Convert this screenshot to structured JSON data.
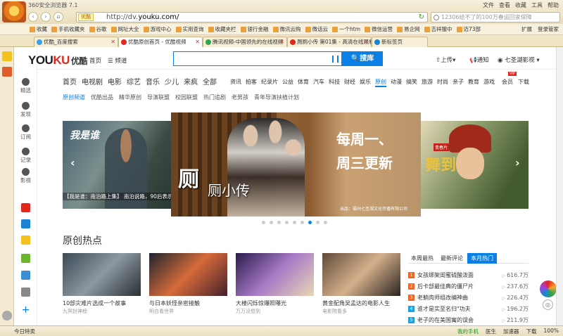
{
  "browser": {
    "title": "360安全浏览器 7.1",
    "menu": [
      "文件",
      "查看",
      "收藏",
      "工具",
      "帮助"
    ],
    "address_badge": "优酷",
    "url_prefix": "http://dv.",
    "url_domain": "youku.com/",
    "search_placeholder": "12306给不了的100万春运回家保障",
    "favorites": [
      "收藏",
      "手机收藏夹",
      "谷歌",
      "网址大全",
      "游戏中心",
      "实用查询",
      "收藏夹栏",
      "银行金融",
      "微讯云购",
      "微话云",
      "一个htm",
      "微信运营",
      "易企网",
      "吉祥服中",
      "迈73部",
      "移动互联",
      "精品采谱"
    ],
    "fav_right": [
      "扩展",
      "登录管家"
    ],
    "tabs": [
      {
        "label": "优酷_百度搜索"
      },
      {
        "label": "优酷原创首页 - 优酷视频"
      },
      {
        "label": "腾讯视频-中国领先的在线视频"
      },
      {
        "label": "厕厕小传 第01集 - 高清在线观看"
      },
      {
        "label": "新标签页"
      }
    ],
    "status_left": "今日特卖",
    "status_right": [
      "我的手机",
      "医生",
      "加速器",
      "下载",
      "100%"
    ]
  },
  "pagenav": [
    "精选",
    "发现",
    "订阅",
    "记录",
    "影视"
  ],
  "youku": {
    "logo_you": "YOU",
    "logo_ku": "KU",
    "logo_cn": "优酷",
    "home": "首页",
    "channel": "频道",
    "search_btn": "搜库",
    "upload": "上传",
    "notice": "通知",
    "user": "七圣湖影视"
  },
  "channels_big": [
    "首页",
    "电视剧",
    "电影",
    "综艺",
    "音乐",
    "少儿",
    "来疯",
    "全部"
  ],
  "channels_small": [
    "资讯",
    "拍客",
    "纪录片",
    "公益",
    "体育",
    "汽车",
    "科技",
    "财经",
    "娱乐",
    "原创",
    "动漫",
    "搞笑",
    "旅游",
    "时尚",
    "亲子",
    "教育",
    "游戏"
  ],
  "member": "会员",
  "vip": "VIP",
  "download": "下载",
  "subnav": [
    "原创频道",
    "优酷出品",
    "精华原创",
    "导演联盟",
    "校园联盟",
    "热门追剧",
    "老男孩",
    "青年导演扶植计划"
  ],
  "carousel": {
    "left_logo": "我是谁",
    "left_caption": "【我是谁：南泊路上集】 南泊说路，90后表示精彩纷呈学霸国人\"嗨啦\"",
    "main_calli": "厕",
    "main_calli2": "厕小传",
    "main_head1": "每周一、",
    "main_head2": "周三更新",
    "main_credit": "出品：福州七圣湖文化传播有限公司",
    "right_text": "舞到",
    "right_tag": "青春片",
    "dots": 9,
    "active_dot": 6
  },
  "hot": {
    "title": "原创热点",
    "items": [
      {
        "title": "10部灾难片选成一个故事",
        "source": "九冥封神榜",
        "colors": [
          "#3b4a55",
          "#8c98a2",
          "#2a2f33"
        ]
      },
      {
        "title": "与日本妖怪亲密接触",
        "source": "明白看世界",
        "colors": [
          "#1e2530",
          "#d66a3a",
          "#44202a"
        ]
      },
      {
        "title": "大楼闪烁惊爆照曝光",
        "source": "万万没想到",
        "colors": [
          "#2a1b4c",
          "#a87ac7",
          "#e8d6b4"
        ]
      },
      {
        "title": "",
        "source": "",
        "colors": [
          "#d41f26",
          "#f3ddd2",
          "#c41c24"
        ]
      },
      {
        "title": "黄金配角吴孟达的电影人生",
        "source": "电影院看多",
        "colors": [
          "#5d4a38",
          "#d6b08c",
          "#2a2420"
        ]
      }
    ],
    "tabs": [
      "本周最热",
      "最新评论",
      "本月热门"
    ],
    "active_tab": 2,
    "ranking": [
      {
        "n": "1",
        "title": "女孩绑架闺蜜硫酸泼面",
        "views": "616.7万",
        "color": "#f26522"
      },
      {
        "n": "2",
        "title": "后卡部最佳典的僵尸片",
        "views": "237.6万",
        "color": "#f26522"
      },
      {
        "n": "3",
        "title": "老躺肉师组改编神曲",
        "views": "226.4万",
        "color": "#f26522"
      },
      {
        "n": "4",
        "title": "谁才是实至名归\"功夫",
        "views": "196.2万",
        "color": "#1aa3e0"
      },
      {
        "n": "5",
        "title": "老子的在美国寓的误会",
        "views": "211.9万",
        "color": "#1aa3e0"
      }
    ]
  }
}
